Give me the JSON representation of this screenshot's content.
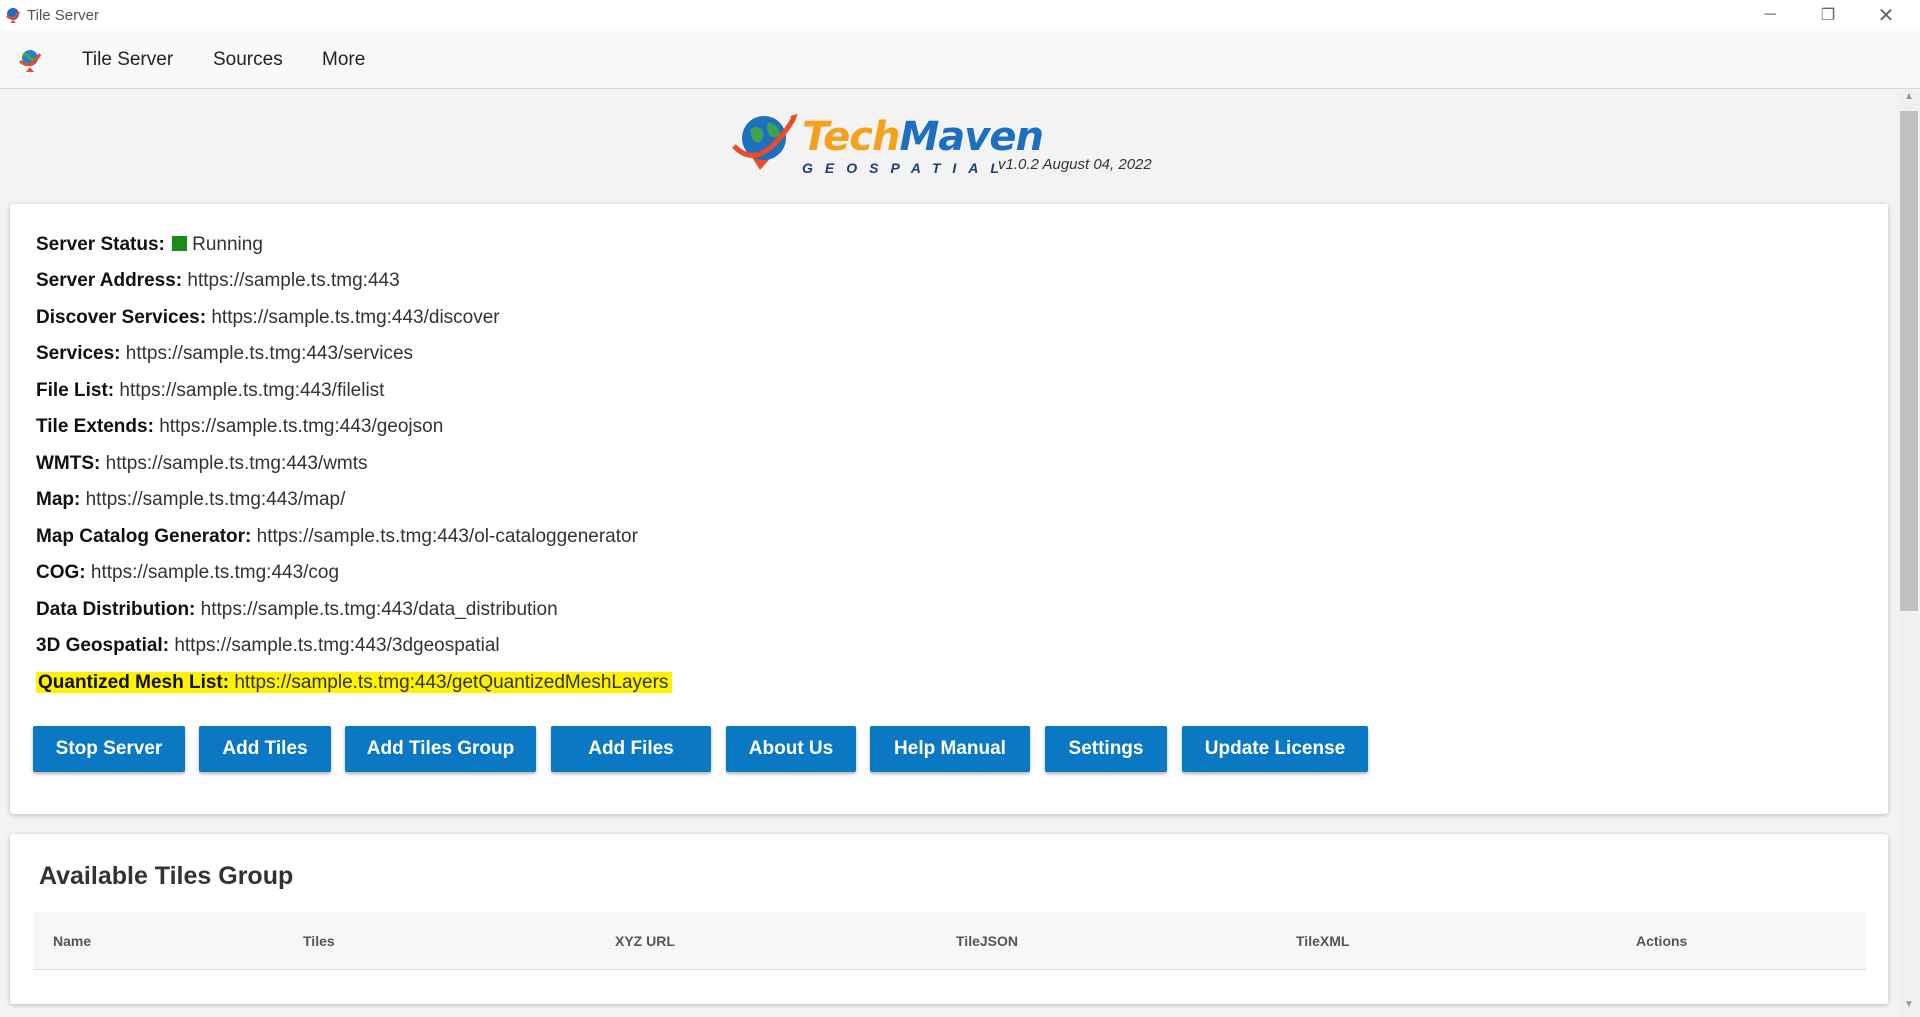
{
  "window": {
    "title": "Tile Server",
    "minimize_icon": "─",
    "restore_icon": "❐",
    "close_icon": "✕"
  },
  "menu": {
    "items": [
      "Tile Server",
      "Sources",
      "More"
    ]
  },
  "header": {
    "brand_part1": "Tech",
    "brand_part2": "Maven",
    "brand_sub": "GEOSPATIAL",
    "version": "v1.0.2 August 04, 2022"
  },
  "server": {
    "status_label": "Server Status:",
    "status_value": "Running",
    "status_color": "#1a8a1a",
    "rows": [
      {
        "label": "Server Address:",
        "value": "https://sample.ts.tmg:443"
      },
      {
        "label": "Discover Services:",
        "value": "https://sample.ts.tmg:443/discover"
      },
      {
        "label": "Services:",
        "value": "https://sample.ts.tmg:443/services"
      },
      {
        "label": "File List:",
        "value": "https://sample.ts.tmg:443/filelist"
      },
      {
        "label": "Tile Extends:",
        "value": "https://sample.ts.tmg:443/geojson"
      },
      {
        "label": "WMTS:",
        "value": "https://sample.ts.tmg:443/wmts"
      },
      {
        "label": "Map:",
        "value": "https://sample.ts.tmg:443/map/"
      },
      {
        "label": "Map Catalog Generator:",
        "value": "https://sample.ts.tmg:443/ol-cataloggenerator"
      },
      {
        "label": "COG:",
        "value": "https://sample.ts.tmg:443/cog"
      },
      {
        "label": "Data Distribution:",
        "value": "https://sample.ts.tmg:443/data_distribution"
      },
      {
        "label": "3D Geospatial:",
        "value": "https://sample.ts.tmg:443/3dgeospatial"
      },
      {
        "label": "Quantized Mesh List:",
        "value": "https://sample.ts.tmg:443/getQuantizedMeshLayers"
      }
    ]
  },
  "buttons": {
    "stop_server": "Stop Server",
    "add_tiles": "Add Tiles",
    "add_tiles_group": "Add Tiles Group",
    "add_files": "Add Files",
    "about_us": "About Us",
    "help_manual": "Help Manual",
    "settings": "Settings",
    "update_license": "Update License",
    "color": "#0a78c2"
  },
  "tiles_group": {
    "title": "Available Tiles Group",
    "columns": [
      "Name",
      "Tiles",
      "XYZ URL",
      "TileJSON",
      "TileXML",
      "Actions"
    ]
  }
}
